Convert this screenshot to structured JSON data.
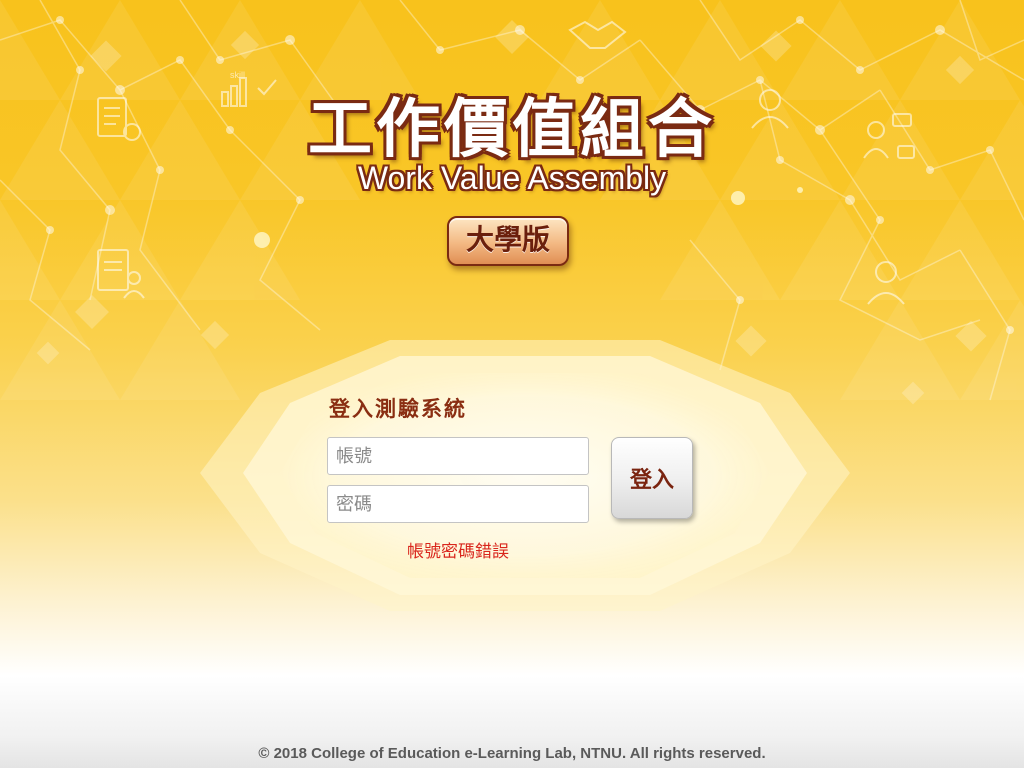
{
  "header": {
    "title_cn": "工作價值組合",
    "title_en": "Work Value Assembly",
    "edition": "大學版"
  },
  "login": {
    "heading": "登入測驗系統",
    "account_placeholder": "帳號",
    "password_placeholder": "密碼",
    "button_label": "登入",
    "error": "帳號密碼錯誤"
  },
  "footer": {
    "copyright": "© 2018 College of Education e-Learning Lab, NTNU. All rights reserved."
  },
  "decor": {
    "background_icons": [
      "checklist-icon",
      "skill-chart-icon",
      "handshake-icon",
      "document-person-icon",
      "businessman-icon",
      "meeting-icon",
      "person-icon"
    ],
    "skill_label": "skill"
  },
  "colors": {
    "background": "#f8c21c",
    "title_outline": "#7a2a12",
    "heading": "#8a2e12",
    "error": "#d9261c",
    "badge": "#f3b983"
  }
}
